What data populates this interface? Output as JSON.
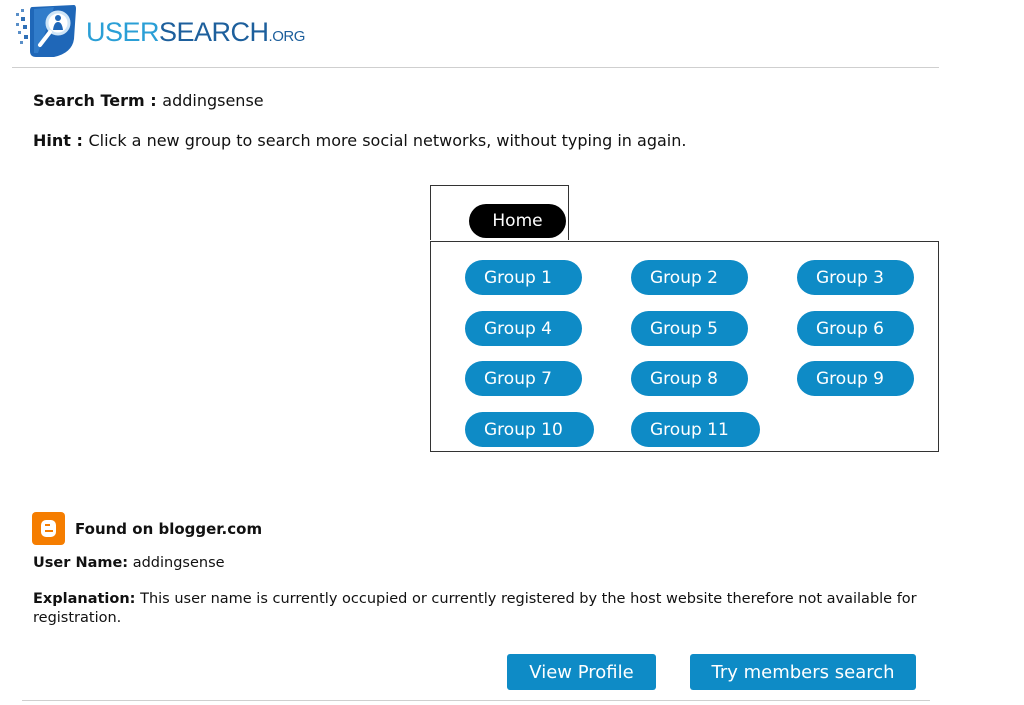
{
  "brand": {
    "logo_icon": "user-search-magnifier-icon",
    "name_part1": "USER",
    "name_part2": "SEARCH",
    "name_part3": ".ORG",
    "colors": {
      "light_blue": "#2a9fd6",
      "dark_blue": "#1d5f9c"
    }
  },
  "search": {
    "term_label": "Search Term",
    "separator": " : ",
    "term_value": "addingsense",
    "hint_label": "Hint",
    "hint_text": "Click a new group to search more social networks, without typing in again."
  },
  "nav": {
    "home_label": "Home",
    "groups": [
      "Group 1",
      "Group 2",
      "Group 3",
      "Group 4",
      "Group 5",
      "Group 6",
      "Group 7",
      "Group 8",
      "Group 9",
      "Group 10",
      "Group 11"
    ],
    "colors": {
      "home_bg": "#000000",
      "group_bg": "#0e8bc6"
    }
  },
  "result": {
    "site_icon": "blogger-icon",
    "found_text": "Found on blogger.com",
    "username_label": "User Name:",
    "username_value": "addingsense",
    "explanation_label": "Explanation:",
    "explanation_text": "This user name is currently occupied or currently registered by the host website therefore not available for registration.",
    "view_profile_label": "View Profile",
    "members_search_label": "Try members search",
    "colors": {
      "button_bg": "#0e8bc6",
      "blogger_orange": "#f57d00"
    }
  }
}
